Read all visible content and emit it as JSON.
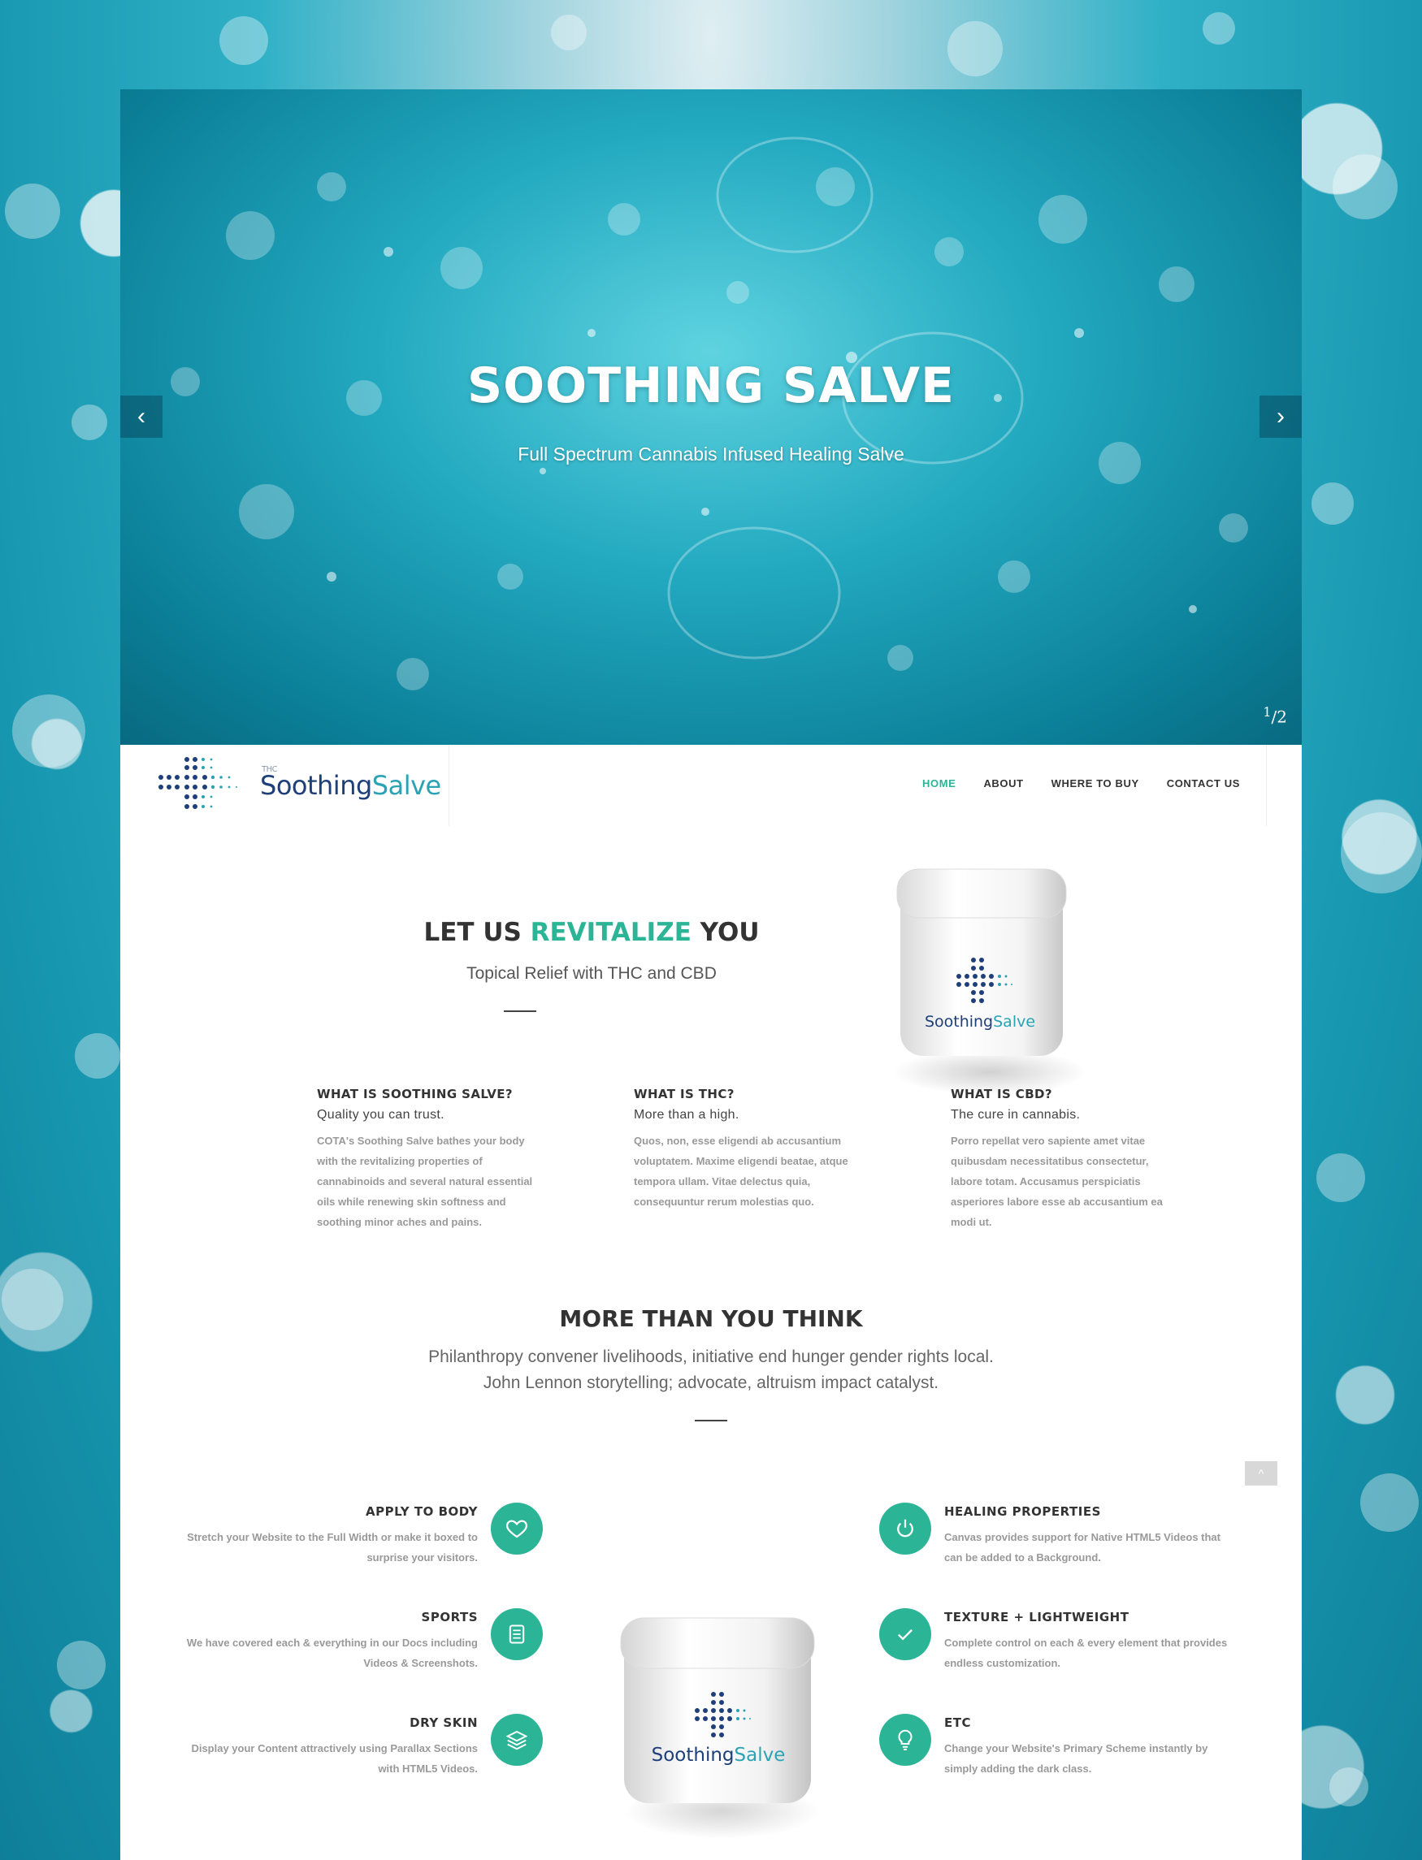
{
  "slider": {
    "title": "SOOTHING SALVE",
    "subtitle": "Full Spectrum Cannabis Infused Healing Salve",
    "counter_current": "1",
    "counter_total": "2"
  },
  "brand": {
    "name_part1": "Soothing",
    "name_part2": "Salve",
    "thc": "THC",
    "accent_color": "#2bb596"
  },
  "nav": {
    "items": [
      "HOME",
      "ABOUT",
      "WHERE TO BUY",
      "CONTACT US"
    ],
    "active": "HOME"
  },
  "intro": {
    "title_pre": "LET US ",
    "title_accent": "REVITALIZE",
    "title_post": " YOU",
    "subtitle": "Topical Relief with THC and CBD"
  },
  "features": [
    {
      "title": "WHAT IS SOOTHING SALVE?",
      "tagline": "Quality you can trust.",
      "body": "COTA's Soothing Salve bathes your body with the revitalizing properties of cannabinoids and several natural essential oils while renewing skin softness and soothing minor aches and pains."
    },
    {
      "title": "WHAT IS THC?",
      "tagline": "More than a high.",
      "body": "Quos, non, esse eligendi ab accusantium voluptatem. Maxime eligendi beatae, atque tempora ullam. Vitae delectus quia, consequuntur rerum molestias quo."
    },
    {
      "title": "WHAT IS CBD?",
      "tagline": "The cure in cannabis.",
      "body": "Porro repellat vero sapiente amet vitae quibusdam necessitatibus consectetur, labore totam. Accusamus perspiciatis asperiores labore esse ab accusantium ea modi ut."
    }
  ],
  "section": {
    "title": "MORE THAN YOU THINK",
    "lead_line1": "Philanthropy convener livelihoods, initiative end hunger gender rights local.",
    "lead_line2": "John Lennon storytelling; advocate, altruism impact catalyst."
  },
  "benefits_left": [
    {
      "title": "APPLY TO BODY",
      "body": "Stretch your Website to the Full Width or make it boxed to surprise your visitors.",
      "icon": "heart-icon"
    },
    {
      "title": "SPORTS",
      "body": "We have covered each & everything in our Docs including Videos & Screenshots.",
      "icon": "document-icon"
    },
    {
      "title": "DRY SKIN",
      "body": "Display your Content attractively using Parallax Sections with HTML5 Videos.",
      "icon": "layers-icon"
    }
  ],
  "benefits_right": [
    {
      "title": "HEALING PROPERTIES",
      "body": "Canvas provides support for Native HTML5 Videos that can be added to a Background.",
      "icon": "power-icon"
    },
    {
      "title": "TEXTURE + LIGHTWEIGHT",
      "body": "Complete control on each & every element that provides endless customization.",
      "icon": "check-icon"
    },
    {
      "title": "ETC",
      "body": "Change your Website's Primary Scheme instantly by simply adding the dark class.",
      "icon": "lightbulb-icon"
    }
  ]
}
